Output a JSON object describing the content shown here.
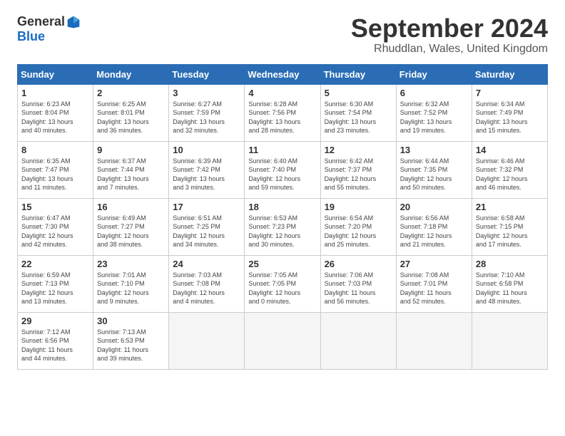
{
  "logo": {
    "general": "General",
    "blue": "Blue"
  },
  "header": {
    "month": "September 2024",
    "location": "Rhuddlan, Wales, United Kingdom"
  },
  "weekdays": [
    "Sunday",
    "Monday",
    "Tuesday",
    "Wednesday",
    "Thursday",
    "Friday",
    "Saturday"
  ],
  "weeks": [
    [
      {
        "day": "1",
        "info": "Sunrise: 6:23 AM\nSunset: 8:04 PM\nDaylight: 13 hours\nand 40 minutes."
      },
      {
        "day": "2",
        "info": "Sunrise: 6:25 AM\nSunset: 8:01 PM\nDaylight: 13 hours\nand 36 minutes."
      },
      {
        "day": "3",
        "info": "Sunrise: 6:27 AM\nSunset: 7:59 PM\nDaylight: 13 hours\nand 32 minutes."
      },
      {
        "day": "4",
        "info": "Sunrise: 6:28 AM\nSunset: 7:56 PM\nDaylight: 13 hours\nand 28 minutes."
      },
      {
        "day": "5",
        "info": "Sunrise: 6:30 AM\nSunset: 7:54 PM\nDaylight: 13 hours\nand 23 minutes."
      },
      {
        "day": "6",
        "info": "Sunrise: 6:32 AM\nSunset: 7:52 PM\nDaylight: 13 hours\nand 19 minutes."
      },
      {
        "day": "7",
        "info": "Sunrise: 6:34 AM\nSunset: 7:49 PM\nDaylight: 13 hours\nand 15 minutes."
      }
    ],
    [
      {
        "day": "8",
        "info": "Sunrise: 6:35 AM\nSunset: 7:47 PM\nDaylight: 13 hours\nand 11 minutes."
      },
      {
        "day": "9",
        "info": "Sunrise: 6:37 AM\nSunset: 7:44 PM\nDaylight: 13 hours\nand 7 minutes."
      },
      {
        "day": "10",
        "info": "Sunrise: 6:39 AM\nSunset: 7:42 PM\nDaylight: 13 hours\nand 3 minutes."
      },
      {
        "day": "11",
        "info": "Sunrise: 6:40 AM\nSunset: 7:40 PM\nDaylight: 12 hours\nand 59 minutes."
      },
      {
        "day": "12",
        "info": "Sunrise: 6:42 AM\nSunset: 7:37 PM\nDaylight: 12 hours\nand 55 minutes."
      },
      {
        "day": "13",
        "info": "Sunrise: 6:44 AM\nSunset: 7:35 PM\nDaylight: 12 hours\nand 50 minutes."
      },
      {
        "day": "14",
        "info": "Sunrise: 6:46 AM\nSunset: 7:32 PM\nDaylight: 12 hours\nand 46 minutes."
      }
    ],
    [
      {
        "day": "15",
        "info": "Sunrise: 6:47 AM\nSunset: 7:30 PM\nDaylight: 12 hours\nand 42 minutes."
      },
      {
        "day": "16",
        "info": "Sunrise: 6:49 AM\nSunset: 7:27 PM\nDaylight: 12 hours\nand 38 minutes."
      },
      {
        "day": "17",
        "info": "Sunrise: 6:51 AM\nSunset: 7:25 PM\nDaylight: 12 hours\nand 34 minutes."
      },
      {
        "day": "18",
        "info": "Sunrise: 6:53 AM\nSunset: 7:23 PM\nDaylight: 12 hours\nand 30 minutes."
      },
      {
        "day": "19",
        "info": "Sunrise: 6:54 AM\nSunset: 7:20 PM\nDaylight: 12 hours\nand 25 minutes."
      },
      {
        "day": "20",
        "info": "Sunrise: 6:56 AM\nSunset: 7:18 PM\nDaylight: 12 hours\nand 21 minutes."
      },
      {
        "day": "21",
        "info": "Sunrise: 6:58 AM\nSunset: 7:15 PM\nDaylight: 12 hours\nand 17 minutes."
      }
    ],
    [
      {
        "day": "22",
        "info": "Sunrise: 6:59 AM\nSunset: 7:13 PM\nDaylight: 12 hours\nand 13 minutes."
      },
      {
        "day": "23",
        "info": "Sunrise: 7:01 AM\nSunset: 7:10 PM\nDaylight: 12 hours\nand 9 minutes."
      },
      {
        "day": "24",
        "info": "Sunrise: 7:03 AM\nSunset: 7:08 PM\nDaylight: 12 hours\nand 4 minutes."
      },
      {
        "day": "25",
        "info": "Sunrise: 7:05 AM\nSunset: 7:05 PM\nDaylight: 12 hours\nand 0 minutes."
      },
      {
        "day": "26",
        "info": "Sunrise: 7:06 AM\nSunset: 7:03 PM\nDaylight: 11 hours\nand 56 minutes."
      },
      {
        "day": "27",
        "info": "Sunrise: 7:08 AM\nSunset: 7:01 PM\nDaylight: 11 hours\nand 52 minutes."
      },
      {
        "day": "28",
        "info": "Sunrise: 7:10 AM\nSunset: 6:58 PM\nDaylight: 11 hours\nand 48 minutes."
      }
    ],
    [
      {
        "day": "29",
        "info": "Sunrise: 7:12 AM\nSunset: 6:56 PM\nDaylight: 11 hours\nand 44 minutes."
      },
      {
        "day": "30",
        "info": "Sunrise: 7:13 AM\nSunset: 6:53 PM\nDaylight: 11 hours\nand 39 minutes."
      },
      {
        "day": "",
        "info": ""
      },
      {
        "day": "",
        "info": ""
      },
      {
        "day": "",
        "info": ""
      },
      {
        "day": "",
        "info": ""
      },
      {
        "day": "",
        "info": ""
      }
    ]
  ]
}
